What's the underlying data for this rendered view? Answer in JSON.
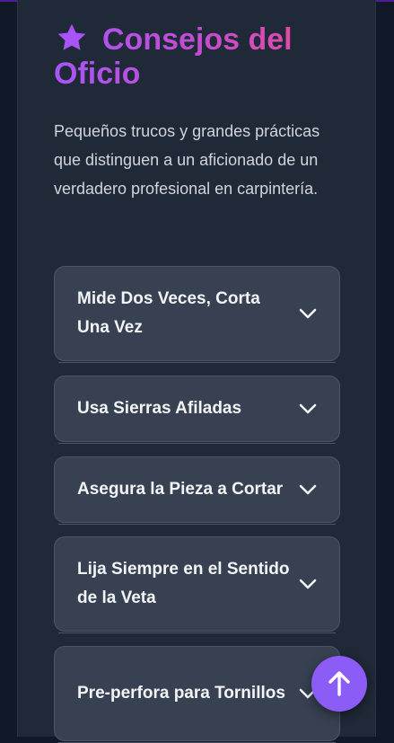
{
  "section": {
    "title": "Consejos del Oficio",
    "icon": "star-icon",
    "intro": "Pequeños trucos y grandes prácticas que distinguen a un aficionado de un verdadero profesional en carpintería."
  },
  "tips": [
    {
      "label": "Mide Dos Veces, Corta Una Vez"
    },
    {
      "label": "Usa Sierras Afiladas"
    },
    {
      "label": "Asegura la Pieza a Cortar"
    },
    {
      "label": "Lija Siempre en el Sentido de la Veta"
    },
    {
      "label": "Pre-perfora para Tornillos"
    }
  ],
  "scroll_top": {
    "icon": "arrow-up-icon"
  },
  "colors": {
    "background": "#111827",
    "panel": "#1f2937",
    "card": "#374151",
    "accent": "#8b5cf6",
    "title_gradient_start": "#a855f7",
    "title_gradient_end": "#ec4899"
  }
}
